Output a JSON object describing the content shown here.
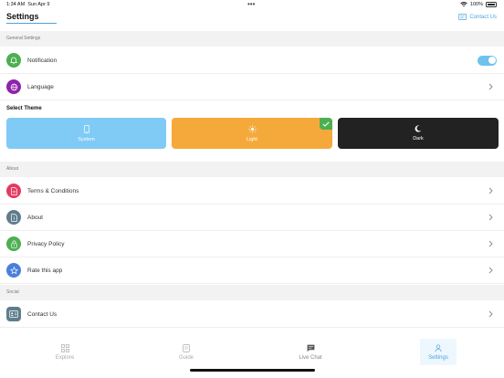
{
  "status_bar": {
    "time": "1:34 AM",
    "date": "Sun Apr 9",
    "battery": "100%"
  },
  "header": {
    "title": "Settings",
    "contact_label": "Contact Us"
  },
  "sections": {
    "general": "General Settings",
    "about": "About",
    "social": "Social"
  },
  "general_items": {
    "notification": "Notification",
    "language": "Language"
  },
  "theme": {
    "title": "Select Theme",
    "system": "System",
    "light": "Light",
    "dark": "Dark",
    "selected": "Light"
  },
  "about_items": {
    "terms": "Terms & Conditions",
    "about": "About",
    "privacy": "Privacy Policy",
    "rate": "Rate this app"
  },
  "social_items": {
    "contact": "Contact Us"
  },
  "tabs": {
    "explore": "Explore",
    "guide": "Guide",
    "live_chat": "Live Chat",
    "settings": "Settings",
    "active": "Settings"
  },
  "colors": {
    "accent": "#4aa3df",
    "notification": "#4caf50",
    "language": "#8e24aa",
    "terms": "#e53961",
    "about": "#5f7d8c",
    "privacy": "#4caf50",
    "rate": "#4a7fdc",
    "contact": "#5f7d8c",
    "theme_system": "#7fcbf5",
    "theme_light": "#f6a93b",
    "theme_dark": "#222222"
  }
}
